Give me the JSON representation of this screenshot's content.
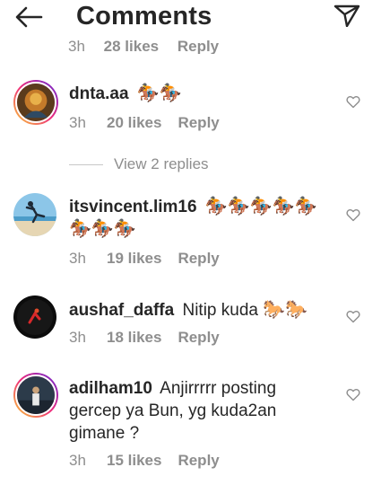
{
  "header": {
    "title": "Comments"
  },
  "clipped_previous": {
    "time": "3h",
    "likes": "28 likes",
    "reply": "Reply"
  },
  "comments": [
    {
      "username": "dnta.aa",
      "text": "",
      "emoji": "🏇🏇",
      "time": "3h",
      "likes": "20 likes",
      "reply": "Reply",
      "view_replies": "View 2 replies"
    },
    {
      "username": "itsvincent.lim16",
      "text": "",
      "emoji": "🏇🏇🏇🏇🏇",
      "emoji_line2": "🏇🏇🏇",
      "time": "3h",
      "likes": "19 likes",
      "reply": "Reply"
    },
    {
      "username": "aushaf_daffa",
      "text": "Nitip kuda",
      "emoji": "🐎🐎",
      "time": "3h",
      "likes": "18 likes",
      "reply": "Reply"
    },
    {
      "username": "adilham10",
      "text": "Anjirrrrr posting",
      "line2": "gercep ya Bun, yg kuda2an",
      "line3": "gimane ?",
      "time": "3h",
      "likes": "15 likes",
      "reply": "Reply"
    }
  ],
  "colors": {
    "text": "#262626",
    "secondary": "#8e8e8e",
    "story_ring_start": "#f9ce34",
    "story_ring_end": "#6228d7"
  }
}
